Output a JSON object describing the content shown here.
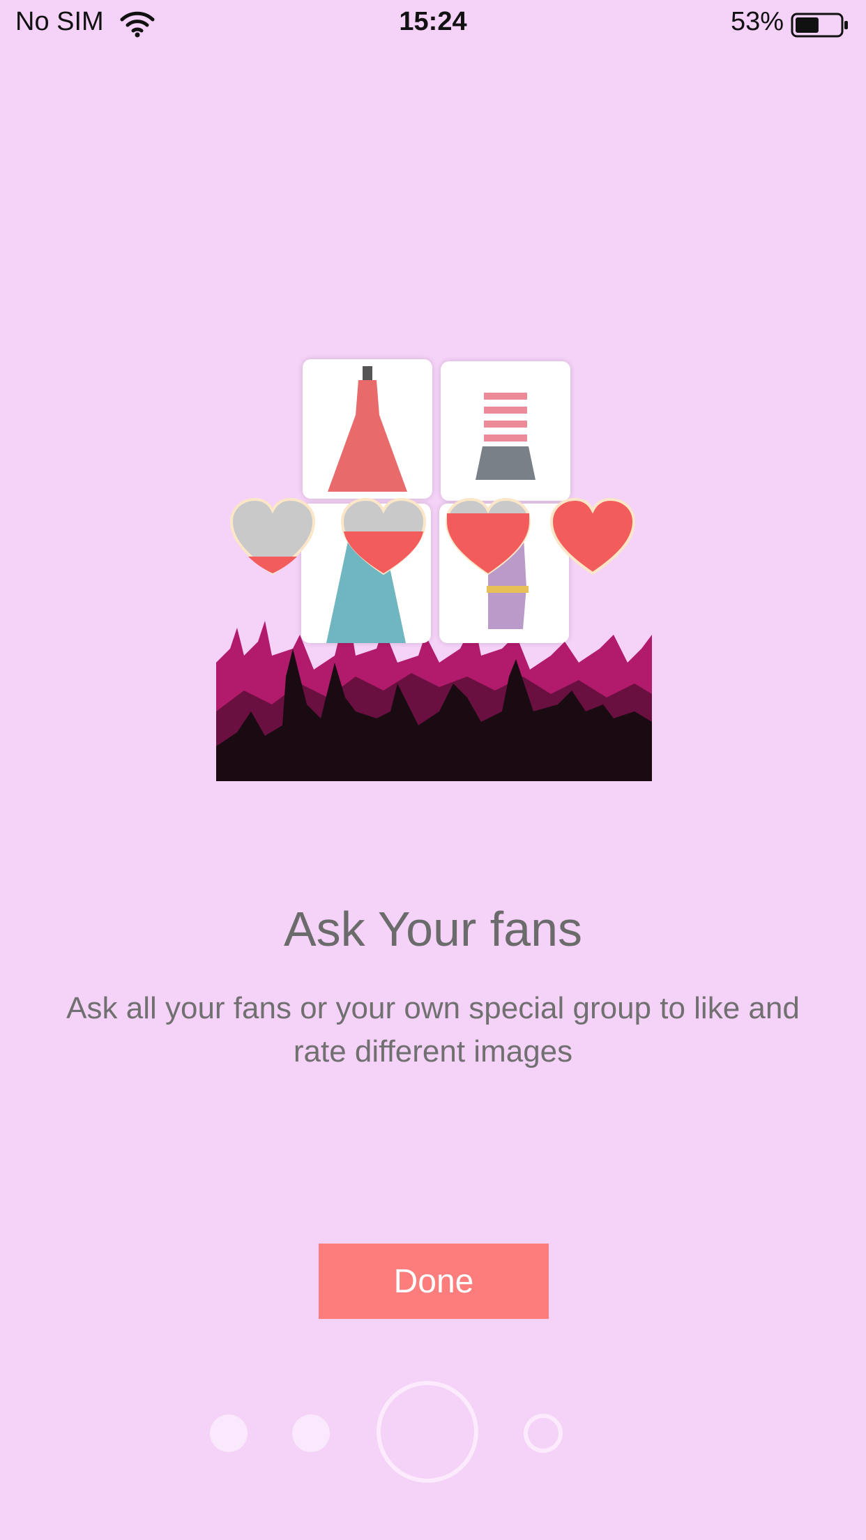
{
  "status_bar": {
    "carrier": "No SIM",
    "time": "15:24",
    "battery": "53%",
    "battery_level": 0.53
  },
  "onboarding": {
    "title": "Ask Your fans",
    "description": "Ask all your fans or your own special group to like and rate different images",
    "done_label": "Done",
    "pager": {
      "pages": 4,
      "current": 3
    }
  },
  "colors": {
    "background": "#f5d2f8",
    "button": "#fc7d7c",
    "heart": "#f25c5c",
    "crowd_back": "#b21b6b",
    "crowd_front": "#1a0a12"
  },
  "icons": [
    "wifi-icon",
    "battery-icon",
    "dress-icon",
    "heart-icon",
    "crowd-silhouette"
  ]
}
